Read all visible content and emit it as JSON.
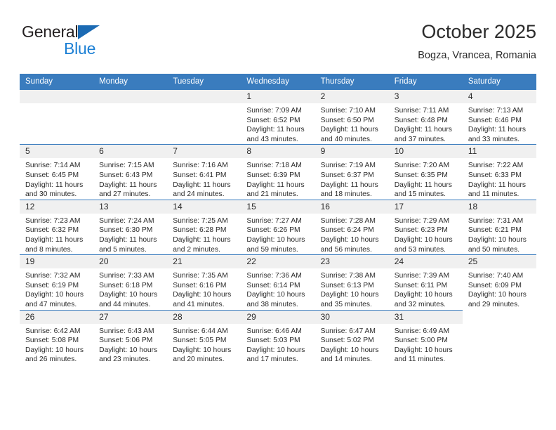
{
  "brand": {
    "name_part1": "General",
    "name_part2": "Blue",
    "triangle_color": "#1b6ab3",
    "blue_color": "#1b7fd4"
  },
  "header": {
    "title": "October 2025",
    "subtitle": "Bogza, Vrancea, Romania"
  },
  "theme": {
    "header_bg": "#3a7cbe",
    "daynum_bg": "#f0f0f0",
    "row_border": "#3a7cbe",
    "text": "#2b2b2b"
  },
  "weekdays": [
    "Sunday",
    "Monday",
    "Tuesday",
    "Wednesday",
    "Thursday",
    "Friday",
    "Saturday"
  ],
  "labels": {
    "sunrise_prefix": "Sunrise:",
    "sunset_prefix": "Sunset:",
    "daylight_prefix": "Daylight:"
  },
  "weeks": [
    [
      {
        "day": "",
        "empty": true
      },
      {
        "day": "",
        "empty": true
      },
      {
        "day": "",
        "empty": true
      },
      {
        "day": "1",
        "sunrise": "Sunrise: 7:09 AM",
        "sunset": "Sunset: 6:52 PM",
        "daylight1": "Daylight: 11 hours",
        "daylight2": "and 43 minutes."
      },
      {
        "day": "2",
        "sunrise": "Sunrise: 7:10 AM",
        "sunset": "Sunset: 6:50 PM",
        "daylight1": "Daylight: 11 hours",
        "daylight2": "and 40 minutes."
      },
      {
        "day": "3",
        "sunrise": "Sunrise: 7:11 AM",
        "sunset": "Sunset: 6:48 PM",
        "daylight1": "Daylight: 11 hours",
        "daylight2": "and 37 minutes."
      },
      {
        "day": "4",
        "sunrise": "Sunrise: 7:13 AM",
        "sunset": "Sunset: 6:46 PM",
        "daylight1": "Daylight: 11 hours",
        "daylight2": "and 33 minutes."
      }
    ],
    [
      {
        "day": "5",
        "sunrise": "Sunrise: 7:14 AM",
        "sunset": "Sunset: 6:45 PM",
        "daylight1": "Daylight: 11 hours",
        "daylight2": "and 30 minutes."
      },
      {
        "day": "6",
        "sunrise": "Sunrise: 7:15 AM",
        "sunset": "Sunset: 6:43 PM",
        "daylight1": "Daylight: 11 hours",
        "daylight2": "and 27 minutes."
      },
      {
        "day": "7",
        "sunrise": "Sunrise: 7:16 AM",
        "sunset": "Sunset: 6:41 PM",
        "daylight1": "Daylight: 11 hours",
        "daylight2": "and 24 minutes."
      },
      {
        "day": "8",
        "sunrise": "Sunrise: 7:18 AM",
        "sunset": "Sunset: 6:39 PM",
        "daylight1": "Daylight: 11 hours",
        "daylight2": "and 21 minutes."
      },
      {
        "day": "9",
        "sunrise": "Sunrise: 7:19 AM",
        "sunset": "Sunset: 6:37 PM",
        "daylight1": "Daylight: 11 hours",
        "daylight2": "and 18 minutes."
      },
      {
        "day": "10",
        "sunrise": "Sunrise: 7:20 AM",
        "sunset": "Sunset: 6:35 PM",
        "daylight1": "Daylight: 11 hours",
        "daylight2": "and 15 minutes."
      },
      {
        "day": "11",
        "sunrise": "Sunrise: 7:22 AM",
        "sunset": "Sunset: 6:33 PM",
        "daylight1": "Daylight: 11 hours",
        "daylight2": "and 11 minutes."
      }
    ],
    [
      {
        "day": "12",
        "sunrise": "Sunrise: 7:23 AM",
        "sunset": "Sunset: 6:32 PM",
        "daylight1": "Daylight: 11 hours",
        "daylight2": "and 8 minutes."
      },
      {
        "day": "13",
        "sunrise": "Sunrise: 7:24 AM",
        "sunset": "Sunset: 6:30 PM",
        "daylight1": "Daylight: 11 hours",
        "daylight2": "and 5 minutes."
      },
      {
        "day": "14",
        "sunrise": "Sunrise: 7:25 AM",
        "sunset": "Sunset: 6:28 PM",
        "daylight1": "Daylight: 11 hours",
        "daylight2": "and 2 minutes."
      },
      {
        "day": "15",
        "sunrise": "Sunrise: 7:27 AM",
        "sunset": "Sunset: 6:26 PM",
        "daylight1": "Daylight: 10 hours",
        "daylight2": "and 59 minutes."
      },
      {
        "day": "16",
        "sunrise": "Sunrise: 7:28 AM",
        "sunset": "Sunset: 6:24 PM",
        "daylight1": "Daylight: 10 hours",
        "daylight2": "and 56 minutes."
      },
      {
        "day": "17",
        "sunrise": "Sunrise: 7:29 AM",
        "sunset": "Sunset: 6:23 PM",
        "daylight1": "Daylight: 10 hours",
        "daylight2": "and 53 minutes."
      },
      {
        "day": "18",
        "sunrise": "Sunrise: 7:31 AM",
        "sunset": "Sunset: 6:21 PM",
        "daylight1": "Daylight: 10 hours",
        "daylight2": "and 50 minutes."
      }
    ],
    [
      {
        "day": "19",
        "sunrise": "Sunrise: 7:32 AM",
        "sunset": "Sunset: 6:19 PM",
        "daylight1": "Daylight: 10 hours",
        "daylight2": "and 47 minutes."
      },
      {
        "day": "20",
        "sunrise": "Sunrise: 7:33 AM",
        "sunset": "Sunset: 6:18 PM",
        "daylight1": "Daylight: 10 hours",
        "daylight2": "and 44 minutes."
      },
      {
        "day": "21",
        "sunrise": "Sunrise: 7:35 AM",
        "sunset": "Sunset: 6:16 PM",
        "daylight1": "Daylight: 10 hours",
        "daylight2": "and 41 minutes."
      },
      {
        "day": "22",
        "sunrise": "Sunrise: 7:36 AM",
        "sunset": "Sunset: 6:14 PM",
        "daylight1": "Daylight: 10 hours",
        "daylight2": "and 38 minutes."
      },
      {
        "day": "23",
        "sunrise": "Sunrise: 7:38 AM",
        "sunset": "Sunset: 6:13 PM",
        "daylight1": "Daylight: 10 hours",
        "daylight2": "and 35 minutes."
      },
      {
        "day": "24",
        "sunrise": "Sunrise: 7:39 AM",
        "sunset": "Sunset: 6:11 PM",
        "daylight1": "Daylight: 10 hours",
        "daylight2": "and 32 minutes."
      },
      {
        "day": "25",
        "sunrise": "Sunrise: 7:40 AM",
        "sunset": "Sunset: 6:09 PM",
        "daylight1": "Daylight: 10 hours",
        "daylight2": "and 29 minutes."
      }
    ],
    [
      {
        "day": "26",
        "sunrise": "Sunrise: 6:42 AM",
        "sunset": "Sunset: 5:08 PM",
        "daylight1": "Daylight: 10 hours",
        "daylight2": "and 26 minutes."
      },
      {
        "day": "27",
        "sunrise": "Sunrise: 6:43 AM",
        "sunset": "Sunset: 5:06 PM",
        "daylight1": "Daylight: 10 hours",
        "daylight2": "and 23 minutes."
      },
      {
        "day": "28",
        "sunrise": "Sunrise: 6:44 AM",
        "sunset": "Sunset: 5:05 PM",
        "daylight1": "Daylight: 10 hours",
        "daylight2": "and 20 minutes."
      },
      {
        "day": "29",
        "sunrise": "Sunrise: 6:46 AM",
        "sunset": "Sunset: 5:03 PM",
        "daylight1": "Daylight: 10 hours",
        "daylight2": "and 17 minutes."
      },
      {
        "day": "30",
        "sunrise": "Sunrise: 6:47 AM",
        "sunset": "Sunset: 5:02 PM",
        "daylight1": "Daylight: 10 hours",
        "daylight2": "and 14 minutes."
      },
      {
        "day": "31",
        "sunrise": "Sunrise: 6:49 AM",
        "sunset": "Sunset: 5:00 PM",
        "daylight1": "Daylight: 10 hours",
        "daylight2": "and 11 minutes."
      },
      {
        "day": "",
        "empty": true,
        "tail": true
      }
    ]
  ]
}
